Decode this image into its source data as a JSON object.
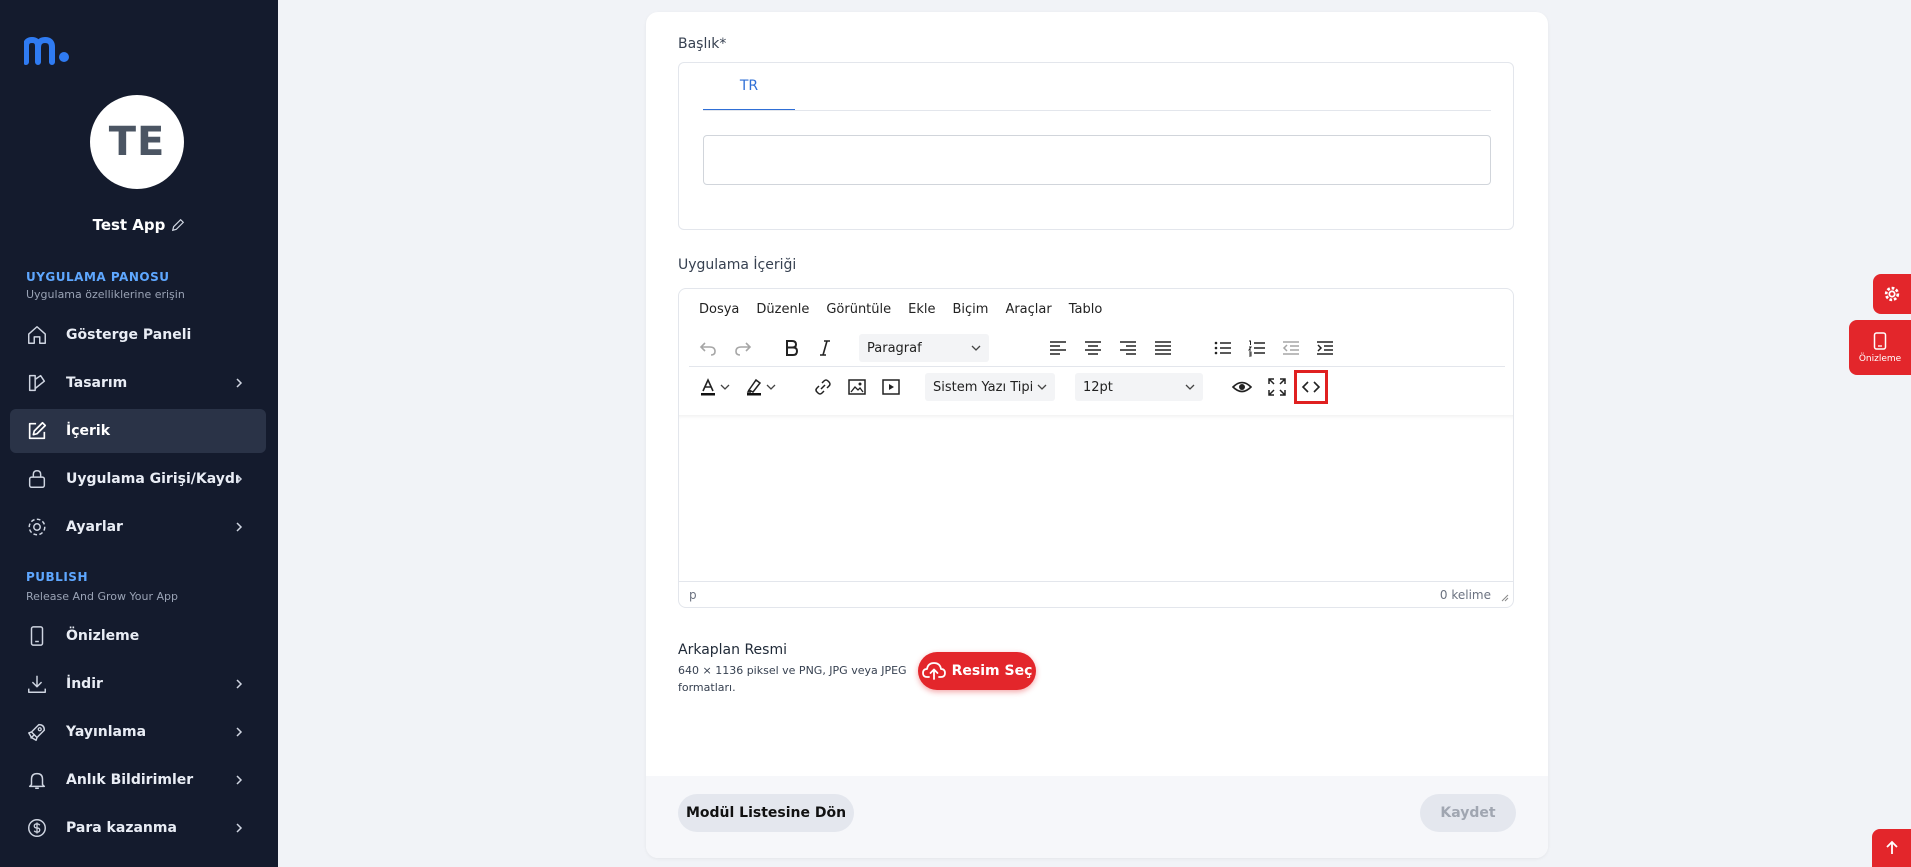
{
  "sidebar": {
    "avatar_initials": "TE",
    "app_name": "Test App",
    "sections": [
      {
        "title": "UYGULAMA PANOSU",
        "subtitle": "Uygulama özelliklerine erişin"
      },
      {
        "title": "PUBLISH",
        "subtitle": "Release And Grow Your App"
      }
    ],
    "items": [
      {
        "label": "Gösterge Paneli",
        "icon": "home-icon"
      },
      {
        "label": "Tasarım",
        "icon": "design-icon"
      },
      {
        "label": "İçerik",
        "icon": "edit-icon"
      },
      {
        "label": "Uygulama Girişi/Kaydı",
        "icon": "lock-icon"
      },
      {
        "label": "Ayarlar",
        "icon": "gear-icon"
      },
      {
        "label": "Önizleme",
        "icon": "phone-icon"
      },
      {
        "label": "İndir",
        "icon": "download-icon"
      },
      {
        "label": "Yayınlama",
        "icon": "rocket-icon"
      },
      {
        "label": "Anlık Bildirimler",
        "icon": "bell-icon"
      },
      {
        "label": "Para kazanma",
        "icon": "dollar-icon"
      }
    ]
  },
  "form": {
    "title_label": "Başlık*",
    "lang_tab": "TR",
    "title_value": "",
    "content_label": "Uygulama İçeriği"
  },
  "editor": {
    "menu": [
      "Dosya",
      "Düzenle",
      "Görüntüle",
      "Ekle",
      "Biçim",
      "Araçlar",
      "Tablo"
    ],
    "block_format": "Paragraf",
    "font_family": "Sistem Yazı Tipi",
    "font_size": "12pt",
    "status_path": "p",
    "word_count": "0 kelime"
  },
  "background": {
    "title": "Arkaplan Resmi",
    "description": "640 × 1136 piksel ve PNG, JPG veya JPEG formatları.",
    "upload_label": "Resim Seç"
  },
  "footer": {
    "back_label": "Modül Listesine Dön",
    "save_label": "Kaydet"
  },
  "floating": {
    "preview_label": "Önizleme"
  },
  "colors": {
    "sidebar_bg": "#141b2d",
    "accent_blue": "#2f6fd6",
    "accent_red": "#e3262b",
    "section_title": "#5ea7ff"
  }
}
